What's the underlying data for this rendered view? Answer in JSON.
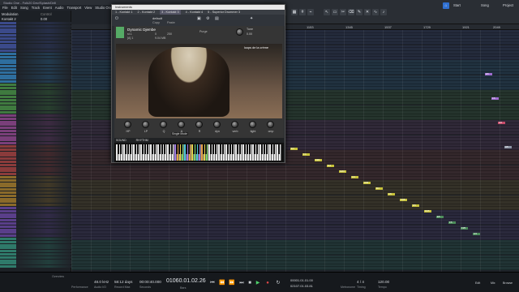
{
  "window": {
    "title": "Studio One - Folk20 Dev/Splash/Drill",
    "controls": [
      "–",
      "□",
      "✕"
    ]
  },
  "menu": [
    "File",
    "Edit",
    "Song",
    "Track",
    "Event",
    "Audio",
    "Transport",
    "View",
    "Studio One",
    "Help"
  ],
  "toolbar": {
    "snap_label": "Snap",
    "snap_value": "Adaptive",
    "start_label": "Start",
    "song_label": "Song",
    "project_label": "Project"
  },
  "inspector": {
    "title": "Modulation",
    "control_label": "Control",
    "instrument": "Kontakt 2",
    "value": "0.00"
  },
  "ruler": [
    "1153",
    "1345",
    "1537",
    "1729",
    "1921",
    "2049"
  ],
  "instrument_window": {
    "title": "Instruments",
    "tabs": [
      "1 - Kontakt 1",
      "2 - Kontakt 2",
      "3 - Kontakt 3",
      "4 - Kontakt 4",
      "5 - Superior Drummer 3"
    ],
    "preset": "default",
    "copy_label": "Copy",
    "paste_label": "Paste",
    "instrument_name": "Dynamic Djembe",
    "output": "st.1",
    "voices": "0",
    "max": "250",
    "midi_ch": "[A] 1",
    "memory": "9.04 MB",
    "tune_label": "Tune",
    "tune_value": "0.00",
    "purge_label": "Purge",
    "brand": "loops de la crème",
    "knob_labels": [
      "HP",
      "LP",
      "Q",
      "A",
      "R",
      "dyn",
      "verb",
      "tight",
      "cmp"
    ],
    "mode_value": "Single Mode",
    "tab_sound": "SOUND",
    "tab_rhythm": "RHYTHM"
  },
  "notes": [
    {
      "label": "E4",
      "color": "y"
    },
    {
      "label": "F4",
      "color": "y"
    },
    {
      "label": "F#4",
      "color": "y"
    },
    {
      "label": "G4",
      "color": "y"
    },
    {
      "label": "G#4",
      "color": "y"
    },
    {
      "label": "A4",
      "color": "y"
    },
    {
      "label": "A#4",
      "color": "y"
    },
    {
      "label": "B4",
      "color": "y"
    },
    {
      "label": "C5",
      "color": "y"
    },
    {
      "label": "C#5",
      "color": "y"
    },
    {
      "label": "D5",
      "color": "y"
    },
    {
      "label": "D#5",
      "color": "y"
    },
    {
      "label": "E5",
      "color": "g"
    },
    {
      "label": "F5",
      "color": "g"
    },
    {
      "label": "F#5",
      "color": "g"
    },
    {
      "label": "G5",
      "color": "g"
    },
    {
      "label": "E5",
      "color": "p"
    },
    {
      "label": "F5",
      "color": "p"
    },
    {
      "label": "G5",
      "color": "r"
    },
    {
      "label": "A5",
      "color": "b"
    }
  ],
  "transport": {
    "sample_rate": "48.0 kHz",
    "sr_label": "Audio I/O",
    "max_rec": "58:12 days",
    "max_rec_label": "Record Max",
    "seconds": "00:00:40.000",
    "seconds_label": "Seconds",
    "position": "01060.01.02.26",
    "position_label": "Bars",
    "loop_start": "00001.01.01.00",
    "loop_end": "02107.01.03.81",
    "tempo": "120.00",
    "tempo_label": "Tempo",
    "signature": "4 / 4",
    "signature_label": "Timing",
    "metronome_label": "Metronome",
    "performance_label": "Performance",
    "edit_label": "Edit",
    "mix_label": "Mix",
    "browse_label": "Browse",
    "overview_label": "Overview"
  },
  "colors": {
    "accent": "#3b7bd9",
    "note_yellow": "#c7c23a"
  }
}
